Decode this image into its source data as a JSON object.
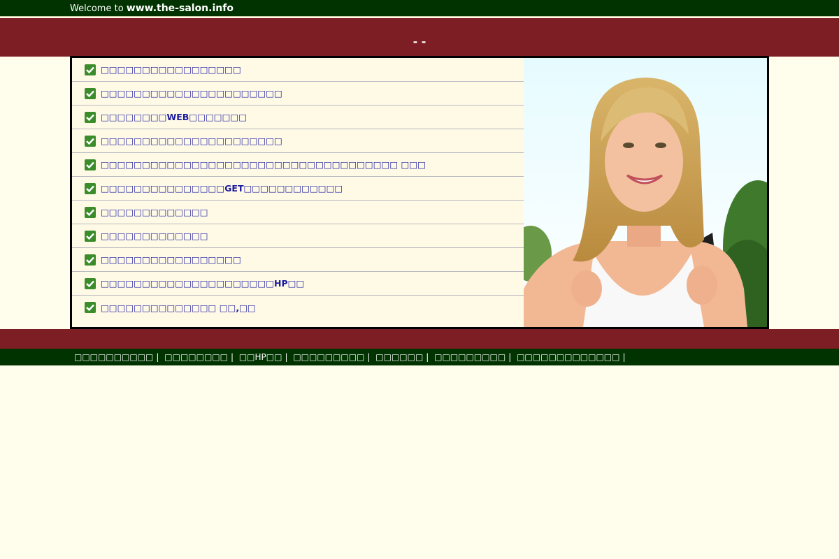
{
  "header": {
    "welcome_text": "Welcome to",
    "site_name": "www.the-salon.info"
  },
  "banner": {
    "title": "- -"
  },
  "list": {
    "items": [
      {
        "label": "□□□□□□□□□□□□□□□□□"
      },
      {
        "label": "□□□□□□□□□□□□□□□□□□□□□□"
      },
      {
        "label": "□□□□□□□□WEB□□□□□□□"
      },
      {
        "label": "□□□□□□□□□□□□□□□□□□□□□□"
      },
      {
        "label": "□□□□□□□□□□□□□□□□□□□□□□□□□□□□□□□□□□□□ □□□"
      },
      {
        "label": "□□□□□□□□□□□□□□□GET□□□□□□□□□□□□"
      },
      {
        "label": "□□□□□□□□□□□□□"
      },
      {
        "label": "□□□□□□□□□□□□□"
      },
      {
        "label": "□□□□□□□□□□□□□□□□□"
      },
      {
        "label": "□□□□□□□□□□□□□□□□□□□□□HP□□"
      },
      {
        "label": "□□□□□□□□□□□□□□ □□,□□"
      }
    ]
  },
  "photo": {
    "alt": "smiling woman with blonde hair carrying a backpack"
  },
  "footer": {
    "links": [
      {
        "label": "□□□□□□□□□□"
      },
      {
        "label": "□□□□□□□□"
      },
      {
        "label": "□□HP□□"
      },
      {
        "label": "□□□□□□□□□"
      },
      {
        "label": "□□□□□□"
      },
      {
        "label": "□□□□□□□□□"
      },
      {
        "label": "□□□□□□□□□□□□□"
      }
    ],
    "separator": "|"
  },
  "colors": {
    "topbar": "#003300",
    "banner": "#7d1e24",
    "page_bg": "#fffdeb",
    "link": "#1a1aa0",
    "check": "#3c8c2c"
  }
}
